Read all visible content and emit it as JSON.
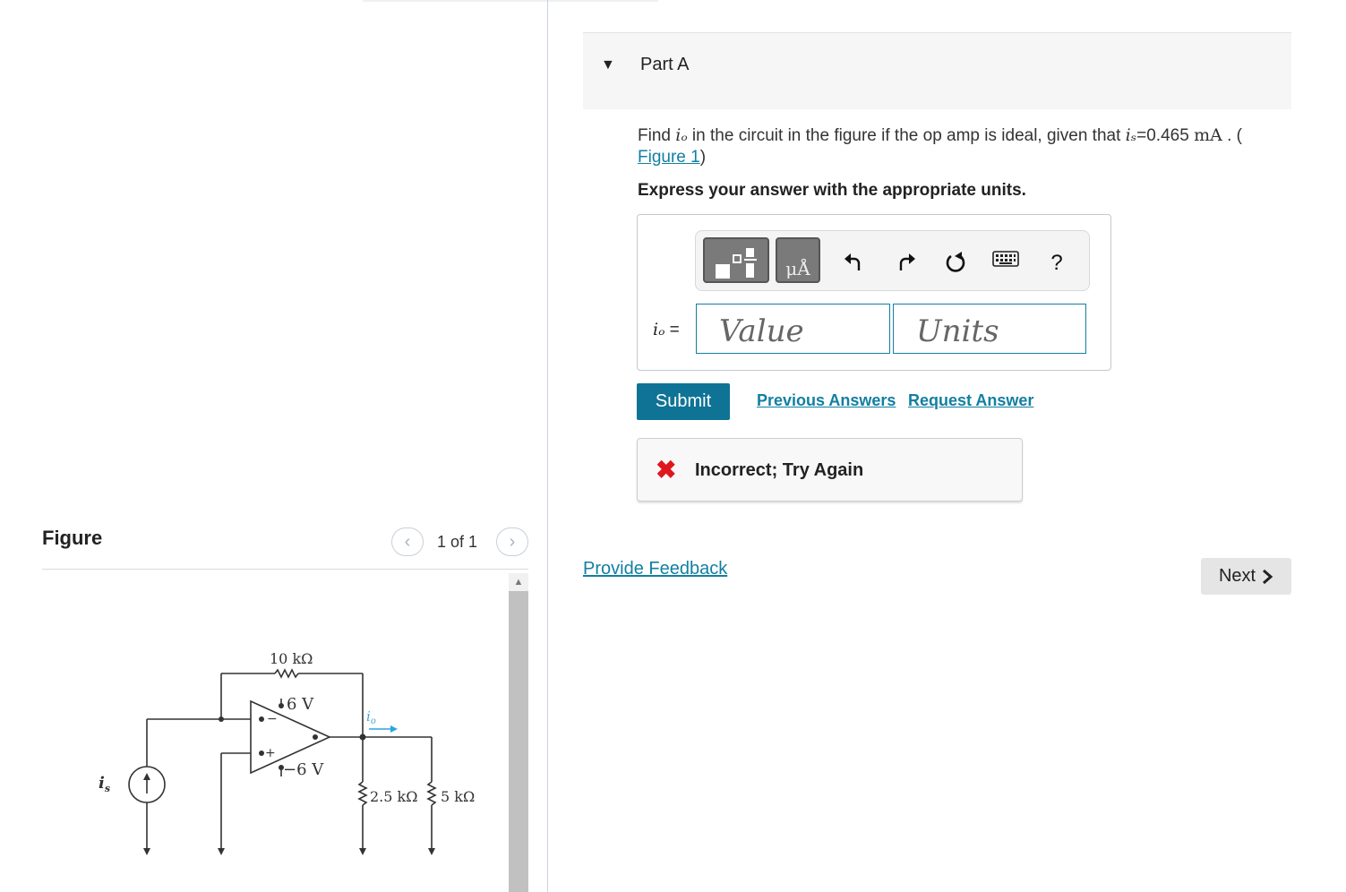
{
  "figure_panel": {
    "title": "Figure",
    "pager": "1 of 1",
    "circuit": {
      "r_feedback": "10 kΩ",
      "v_pos": "6 V",
      "v_neg": "−6 V",
      "r1": "2.5 kΩ",
      "r2": "5 kΩ",
      "source_label": "i",
      "source_sub": "s",
      "output_label": "i",
      "output_sub": "o",
      "minus_sign": "−",
      "plus_sign": "+"
    }
  },
  "part": {
    "title": "Part A",
    "question_pre": "Find ",
    "question_var": "iₒ",
    "question_mid": " in the circuit in the figure if the op amp is ideal, given that ",
    "given_var": "iₛ",
    "given_value": "=0.465 ",
    "given_unit": "mA",
    "question_post": " . (",
    "figure_link": "Figure 1",
    "question_close": ")",
    "instruction": "Express your answer with the appropriate units."
  },
  "answer": {
    "label_var": "iₒ",
    "label_eq": " =",
    "value_placeholder": "Value",
    "units_placeholder": "Units",
    "toolbar": {
      "units_symbol": "μÅ",
      "help": "?"
    }
  },
  "actions": {
    "submit": "Submit",
    "previous_answers": "Previous Answers",
    "request_answer": "Request Answer"
  },
  "feedback": {
    "status": "Incorrect; Try Again",
    "icon": "✖"
  },
  "footer": {
    "provide_feedback": "Provide Feedback",
    "next": "Next"
  }
}
